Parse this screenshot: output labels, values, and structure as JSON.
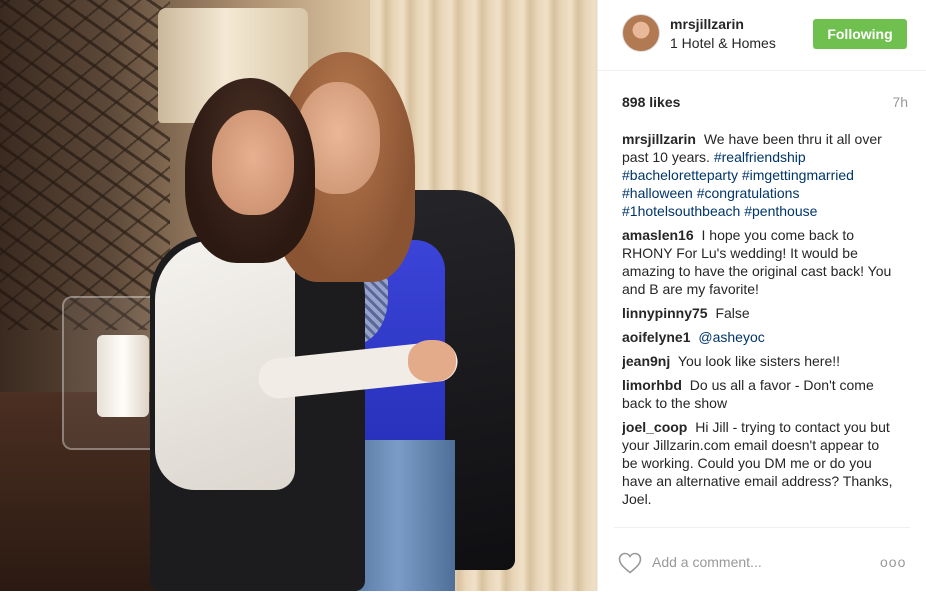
{
  "post": {
    "username": "mrsjillzarin",
    "location": "1 Hotel & Homes",
    "follow_label": "Following",
    "likes": "898 likes",
    "time": "7h"
  },
  "caption": {
    "user": "mrsjillzarin",
    "text": "We have been thru it all over past 10 years.",
    "tags": [
      "#realfriendship",
      "#bacheloretteparty",
      "#imgettingmarried",
      "#halloween",
      "#congratulations",
      "#1hotelsouthbeach",
      "#penthouse"
    ]
  },
  "comments": [
    {
      "user": "amaslen16",
      "text": "I hope you come back to RHONY For Lu's wedding! It would be amazing to have the original cast back! You and B are my favorite!"
    },
    {
      "user": "linnypinny75",
      "text": "False"
    },
    {
      "user": "aoifelyne1",
      "text": "",
      "mention": "@asheyoc"
    },
    {
      "user": "jean9nj",
      "text": "You look like sisters here!!"
    },
    {
      "user": "limorhbd",
      "text": "Do us all a favor - Don't come back to the show"
    },
    {
      "user": "joel_coop",
      "text": "Hi Jill - trying to contact you but your Jillzarin.com email doesn't appear to be working. Could you DM me or do you have an alternative email address? Thanks, Joel."
    }
  ],
  "footer": {
    "comment_placeholder": "Add a comment...",
    "more_label": "ooo"
  },
  "icons": {
    "like": "heart-icon",
    "more": "more-options-icon"
  },
  "colors": {
    "follow_button": "#70c050",
    "hashtag": "#003569",
    "muted": "#999999"
  }
}
